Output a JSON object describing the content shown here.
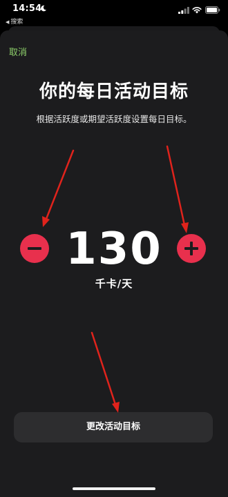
{
  "status_bar": {
    "time": "14:54",
    "back_label": "搜索"
  },
  "sheet": {
    "cancel_label": "取消",
    "title": "你的每日活动目标",
    "subtitle": "根据活跃度或期望活跃度设置每日目标。",
    "goal_value": "130",
    "goal_unit": "千卡/天",
    "change_button_label": "更改活动目标"
  },
  "icons": {
    "moon": "moon-icon",
    "signal": "cellular-signal-icon",
    "wifi": "wifi-icon",
    "battery": "battery-icon",
    "minus": "minus-icon",
    "plus": "plus-icon",
    "annotation_arrow": "red-arrow-annotation"
  },
  "colors": {
    "accent_green": "#8ed06b",
    "button_red": "#e8304d",
    "annotation_red": "#e0231c",
    "sheet_background": "#1c1c1e"
  }
}
